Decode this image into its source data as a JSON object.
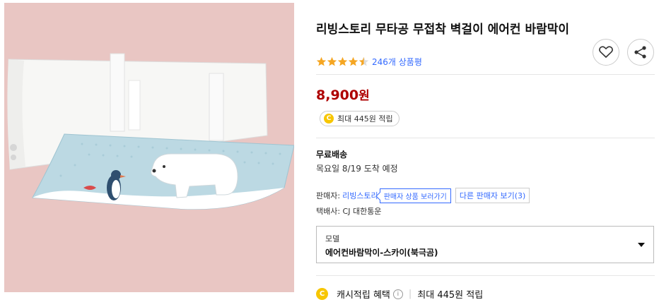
{
  "product": {
    "title": "리빙스토리 무타공 무접착 벽걸이 에어컨 바람막이",
    "rating": 4.5,
    "review_count_label": "246개 상품평",
    "price": "8,900",
    "price_unit": "원",
    "cash_reward": "최대 445원 적립",
    "coin_symbol": "C"
  },
  "shipping": {
    "title": "무료배송",
    "delivery_date": "목요일 8/19 도착 예정"
  },
  "seller": {
    "label": "판매자:",
    "name": "리빙스토리",
    "products_tag": "판매자 상품 보러가기",
    "other_sellers": "다른 판매자 보기(3)",
    "courier": "택배사: CJ 대한통운"
  },
  "option": {
    "label": "모델",
    "value": "에어컨바람막이-스카이(북극곰)"
  },
  "benefit": {
    "label": "캐시적립 혜택",
    "info_symbol": "i",
    "detail": "최대 445원 적립"
  },
  "icons": {
    "wishlist": "heart-icon",
    "share": "share-icon",
    "dropdown": "caret-down-icon"
  },
  "colors": {
    "price": "#ae0000",
    "link": "#346aff",
    "star": "#f5a623",
    "coin": "#f7c600"
  }
}
